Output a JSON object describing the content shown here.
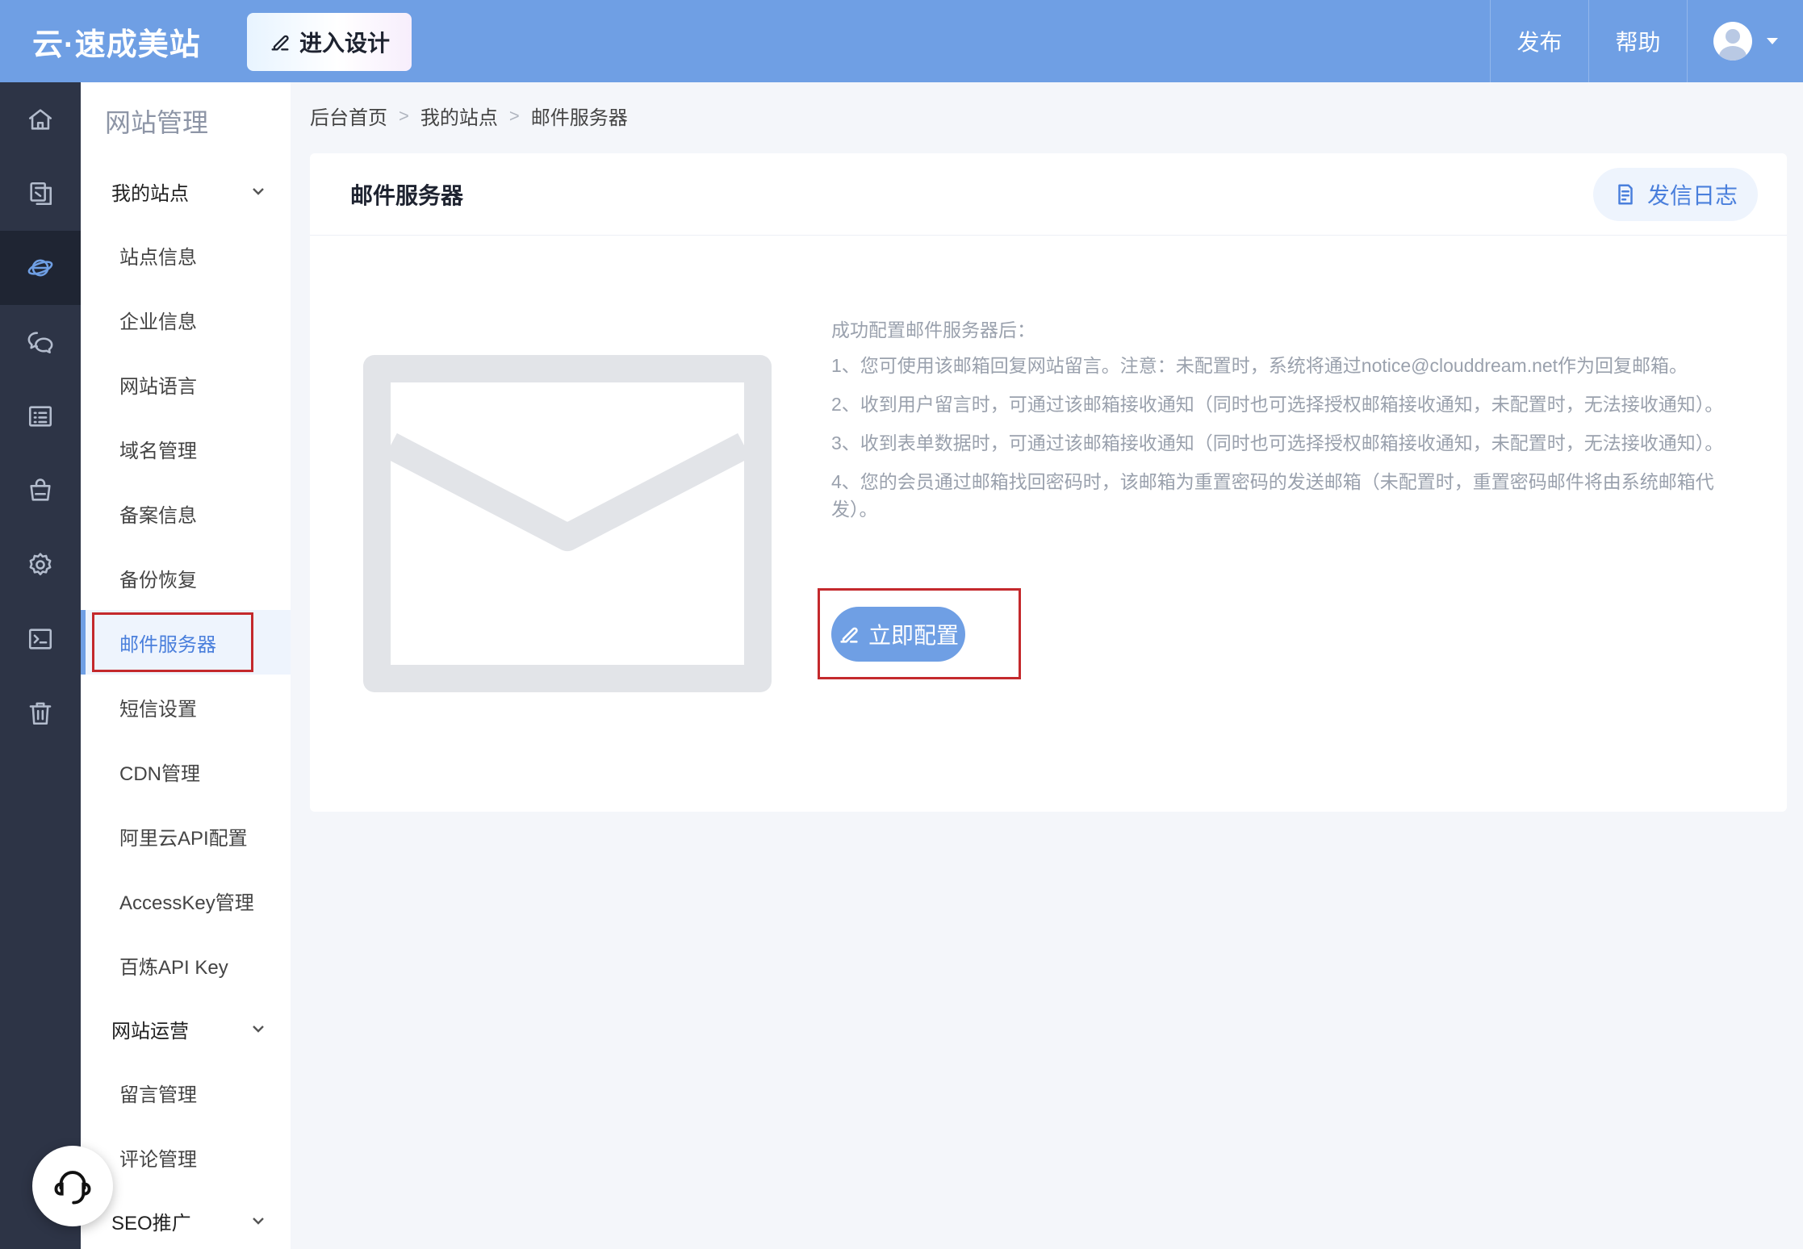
{
  "topbar": {
    "logo": "云·速成美站",
    "design_button": "进入设计",
    "publish": "发布",
    "help": "帮助",
    "icons": [
      "edit-icon",
      "user-avatar",
      "caret-down-icon"
    ]
  },
  "rail": {
    "icons": [
      "home-icon",
      "pages-icon",
      "planet-icon",
      "chat-icon",
      "list-icon",
      "shop-icon",
      "gear-icon",
      "terminal-icon",
      "trash-icon",
      "headset-icon"
    ],
    "active": "planet-icon"
  },
  "sidebar": {
    "title": "网站管理",
    "group_site": "我的站点",
    "items": [
      "站点信息",
      "企业信息",
      "网站语言",
      "域名管理",
      "备案信息",
      "备份恢复",
      "邮件服务器",
      "短信设置",
      "CDN管理",
      "阿里云API配置",
      "AccessKey管理",
      "百炼API Key"
    ],
    "active_item": "邮件服务器",
    "group_ops": "网站运营",
    "ops_items": [
      "留言管理",
      "评论管理"
    ],
    "group_seo": "SEO推广"
  },
  "breadcrumb": {
    "items": [
      "后台首页",
      "我的站点",
      "邮件服务器"
    ],
    "separator": ">"
  },
  "card": {
    "title": "邮件服务器",
    "log_button": "发信日志",
    "intro_title": "成功配置邮件服务器后：",
    "points": [
      "1、您可使用该邮箱回复网站留言。注意：未配置时，系统将通过notice@clouddream.net作为回复邮箱。",
      "2、收到用户留言时，可通过该邮箱接收通知（同时也可选择授权邮箱接收通知，未配置时，无法接收通知）。",
      "3、收到表单数据时，可通过该邮箱接收通知（同时也可选择授权邮箱接收通知，未配置时，无法接收通知）。",
      "4、您的会员通过邮箱找回密码时，该邮箱为重置密码的发送邮箱（未配置时，重置密码邮件将由系统邮箱代发）。"
    ],
    "config_button": "立即配置"
  },
  "colors": {
    "topbar": "#6f9fe4",
    "rail": "#2d3446",
    "accent": "#4a7fdc",
    "highlight": "#c4292c"
  }
}
